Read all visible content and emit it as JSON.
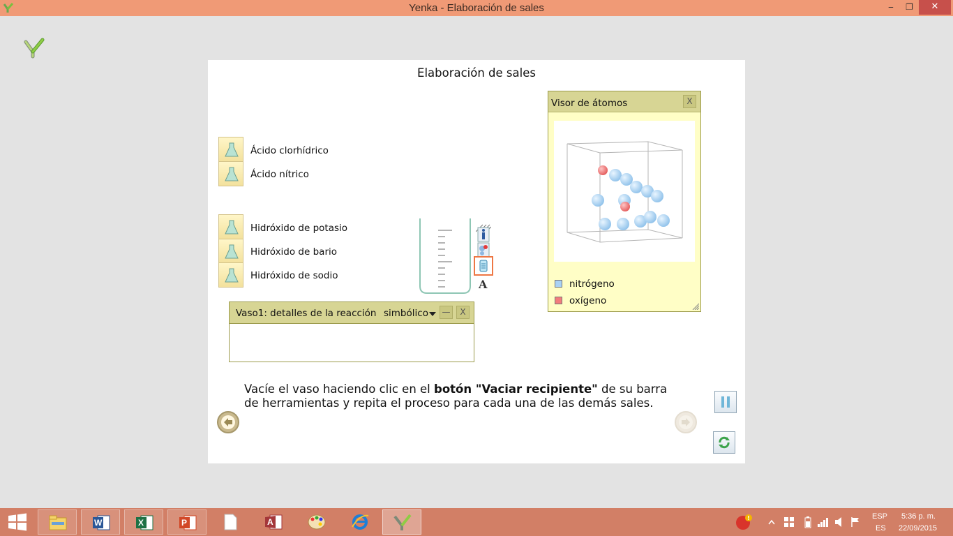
{
  "window": {
    "title": "Yenka - Elaboración de sales",
    "minimize_symbol": "‒",
    "maximize_symbol": "❐",
    "close_symbol": "✕"
  },
  "panel": {
    "title": "Elaboración de sales"
  },
  "chemicals": {
    "acids": [
      "Ácido clorhídrico",
      "Ácido nítrico"
    ],
    "bases": [
      "Hidróxido de potasio",
      "Hidróxido de bario",
      "Hidróxido de sodio"
    ]
  },
  "reaction_window": {
    "title": "Vaso1: detalles de la reacción",
    "mode": "simbólico",
    "minimize_symbol": "—",
    "close_symbol": "X"
  },
  "atom_viewer": {
    "title": "Visor de átomos",
    "close_symbol": "X",
    "legend": [
      {
        "label": "nitrógeno",
        "color": "#a9d2f5"
      },
      {
        "label": "oxígeno",
        "color": "#f27c7c"
      }
    ]
  },
  "instruction": {
    "part1": "Vacíe el vaso haciendo clic en el ",
    "bold": "botón \"Vaciar recipiente\"",
    "part2": " de su barra de herramientas y repita el proceso para cada una de las demás sales."
  },
  "taskbar": {
    "lang_top": "ESP",
    "lang_bottom": "ES",
    "time": "5:36 p. m.",
    "date": "22/09/2015",
    "items": [
      "start",
      "file-explorer",
      "word",
      "excel",
      "powerpoint",
      "blank-document",
      "access",
      "paint",
      "internet-explorer",
      "yenka"
    ]
  },
  "colors": {
    "titlebar": "#f09a76",
    "taskbar": "#d27f66",
    "panel_header": "#d7d594",
    "viewer_bg": "#fffec6"
  }
}
